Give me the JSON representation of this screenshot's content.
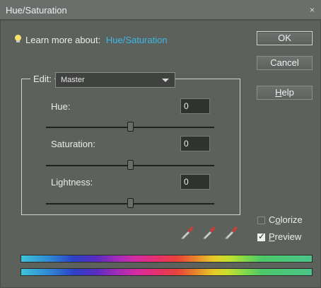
{
  "window": {
    "title": "Hue/Saturation",
    "close_glyph": "×"
  },
  "learn": {
    "prefix": "Learn more about:",
    "link": "Hue/Saturation",
    "icon": "lightbulb-icon"
  },
  "buttons": {
    "ok": "OK",
    "cancel": "Cancel",
    "help_underlined": "H",
    "help_rest": "elp"
  },
  "edit": {
    "label": "Edit:",
    "selected": "Master"
  },
  "adjustments": {
    "hue": {
      "label": "Hue:",
      "value": "0",
      "slider_level": 0.5
    },
    "saturation": {
      "label": "Saturation:",
      "value": "0",
      "slider_level": 0.5
    },
    "lightness": {
      "label": "Lightness:",
      "value": "0",
      "slider_level": 0.5
    }
  },
  "eyedroppers": [
    {
      "icon": "eyedropper-icon"
    },
    {
      "icon": "eyedropper-plus-icon"
    },
    {
      "icon": "eyedropper-minus-icon"
    }
  ],
  "options": {
    "colorize": {
      "label_pre": "C",
      "label_u": "o",
      "label_post": "lorize",
      "checked": false
    },
    "preview": {
      "label_u": "P",
      "label_post": "review",
      "checked": true
    }
  },
  "colors": {
    "background": "#5d615c",
    "link": "#3db8e8",
    "bulb": "#f7e36a"
  }
}
